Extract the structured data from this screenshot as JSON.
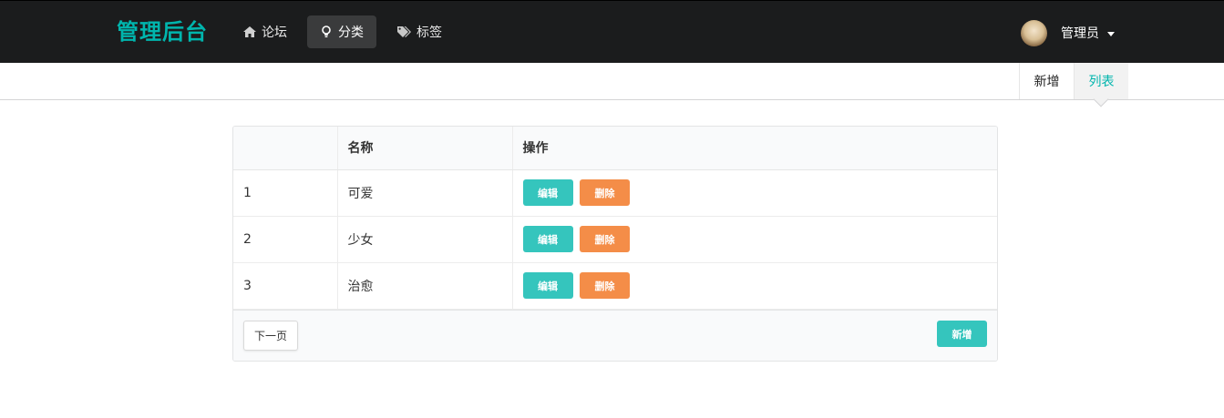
{
  "navbar": {
    "brand": "管理后台",
    "items": [
      {
        "label": "论坛",
        "icon": "home-icon",
        "active": false
      },
      {
        "label": "分类",
        "icon": "lightbulb-icon",
        "active": true
      },
      {
        "label": "标签",
        "icon": "tags-icon",
        "active": false
      }
    ],
    "user": {
      "name": "管理员"
    }
  },
  "submenu": {
    "items": [
      {
        "label": "新增",
        "active": false
      },
      {
        "label": "列表",
        "active": true
      }
    ]
  },
  "table": {
    "headers": [
      "",
      "名称",
      "操作"
    ],
    "rows": [
      {
        "id": "1",
        "name": "可爱"
      },
      {
        "id": "2",
        "name": "少女"
      },
      {
        "id": "3",
        "name": "治愈"
      }
    ],
    "edit_label": "编辑",
    "delete_label": "删除",
    "next_label": "下一页",
    "add_label": "新增"
  },
  "colors": {
    "brand": "#00b5ad",
    "edit": "#35c5bd",
    "delete": "#f48d48",
    "navbar_bg": "#1b1c1d"
  }
}
